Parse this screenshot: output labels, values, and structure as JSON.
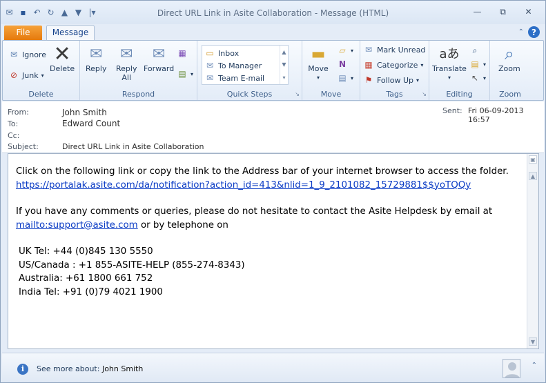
{
  "window": {
    "title": "Direct URL Link in Asite Collaboration  -  Message (HTML)",
    "controls": {
      "minimize": "▭",
      "restore": "⧉",
      "close": "✕"
    }
  },
  "tabs": {
    "file": "File",
    "message": "Message"
  },
  "ribbon": {
    "delete": {
      "label": "Delete",
      "ignore": "Ignore",
      "junk": "Junk",
      "delete": "Delete"
    },
    "respond": {
      "label": "Respond",
      "reply": "Reply",
      "reply_all_1": "Reply",
      "reply_all_2": "All",
      "forward": "Forward"
    },
    "quick_steps": {
      "label": "Quick Steps",
      "items": [
        "Inbox",
        "To Manager",
        "Team E-mail"
      ]
    },
    "move": {
      "label": "Move",
      "move": "Move"
    },
    "tags": {
      "label": "Tags",
      "mark_unread": "Mark Unread",
      "categorize": "Categorize",
      "follow_up": "Follow Up"
    },
    "editing": {
      "label": "Editing",
      "translate": "Translate"
    },
    "zoom": {
      "label": "Zoom",
      "zoom": "Zoom"
    }
  },
  "header": {
    "from_label": "From:",
    "from_value": "John Smith",
    "to_label": "To:",
    "to_value": "Edward Count",
    "cc_label": "Cc:",
    "subject_label": "Subject:",
    "subject_value": "Direct URL Link in Asite Collaboration",
    "sent_label": "Sent:",
    "sent_value": "Fri 06-09-2013 16:57"
  },
  "body": {
    "line1": "Click on the following link or copy the link to the Address bar of your internet browser to access the folder.",
    "link1": "https://portalak.asite.com/da/notification?action_id=413&nlid=1_9_2101082_15729881$$yoTQQy",
    "line2": "If you have any comments or queries, please do not hesitate to contact the Asite Helpdesk by email at",
    "mail_link": "mailto:support@asite.com",
    "line3": " or by telephone on",
    "tel_uk": "UK Tel: +44 (0)845 130 5550",
    "tel_us": "US/Canada  : +1 855-ASITE-HELP (855-274-8343)",
    "tel_au": "Australia: +61 1800 661 752",
    "tel_in": "India Tel: +91 (0)79 4021 1900"
  },
  "bottom": {
    "see_more": "See more about:",
    "person": "John Smith"
  },
  "colors": {
    "file_tab": "#e57a0d",
    "link": "#0b3cc5",
    "ribbon_bg": "#e3ecf8"
  }
}
